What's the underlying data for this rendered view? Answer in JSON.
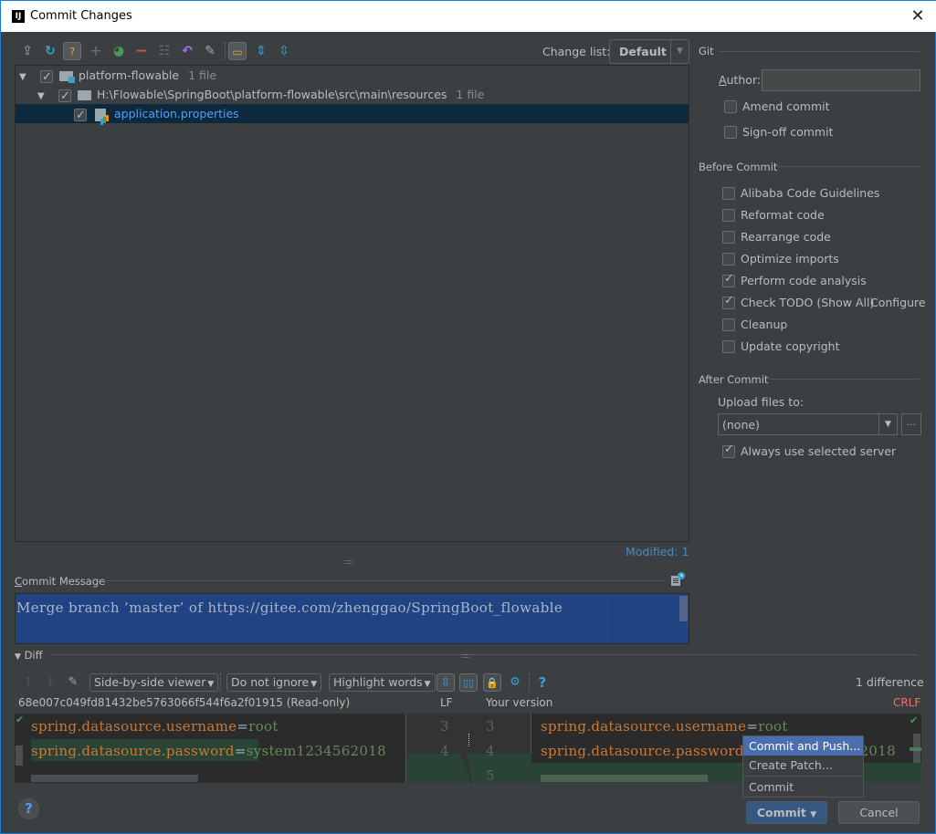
{
  "window": {
    "title": "Commit Changes",
    "logo": "IJ"
  },
  "toolbar": {
    "icons": [
      "vcs-update-icon",
      "refresh-icon",
      "unversioned-files-icon",
      "add-icon",
      "show-diff-icon",
      "remove-icon",
      "group-icon",
      "rollback-icon",
      "edit-source-icon",
      "show-module-icon",
      "expand-all-icon",
      "collapse-all-icon"
    ],
    "change_list_label": "Change list:",
    "change_list_value": "Default"
  },
  "tree": {
    "rows": [
      {
        "label": "platform-flowable",
        "count": "1 file",
        "checked": true
      },
      {
        "label": "H:\\Flowable\\SpringBoot\\platform-flowable\\src\\main\\resources",
        "count": "1 file",
        "checked": true
      },
      {
        "label": "application.properties",
        "checked": true
      }
    ],
    "modified_label": "Modified: 1"
  },
  "git": {
    "section_title": "Git",
    "author_label": "Author:",
    "author_value": "",
    "amend_commit": {
      "label": "Amend commit",
      "checked": false
    },
    "sign_off_commit": {
      "label": "Sign-off commit",
      "checked": false
    }
  },
  "before_commit": {
    "section_title": "Before Commit",
    "options": [
      {
        "label": "Alibaba Code Guidelines",
        "checked": false
      },
      {
        "label": "Reformat code",
        "checked": false
      },
      {
        "label": "Rearrange code",
        "checked": false
      },
      {
        "label": "Optimize imports",
        "checked": false
      },
      {
        "label": "Perform code analysis",
        "checked": true
      },
      {
        "label": "Check TODO (Show All)",
        "checked": true
      },
      {
        "label": "Cleanup",
        "checked": false
      },
      {
        "label": "Update copyright",
        "checked": false
      }
    ],
    "configure_link": "Configure"
  },
  "after_commit": {
    "section_title": "After Commit",
    "upload_label": "Upload files to:",
    "upload_value": "(none)",
    "browse_label": "...",
    "always_use": {
      "label": "Always use selected server",
      "checked": true
    }
  },
  "commit_message": {
    "label": "Commit Message",
    "text": "Merge branch ’master’ of https://gitee.com/zhenggao/SpringBoot_flowable"
  },
  "diff": {
    "section_title": "Diff",
    "viewer_mode": "Side-by-side viewer",
    "ignore_mode": "Do not ignore",
    "highlight_mode": "Highlight words",
    "help": "?",
    "difference_count": "1 difference",
    "left_title": "68e007c049fd81432be5763066f544f6a2f01915 (Read-only)",
    "left_line_sep": "LF",
    "right_title": "Your version",
    "right_line_sep": "CRLF",
    "left_lines": [
      {
        "num": "3",
        "key": "spring.datasource.username",
        "value": "root"
      },
      {
        "num": "4",
        "key": "spring.datasource.password",
        "value": "system1234562018"
      }
    ],
    "right_lines": [
      {
        "num": "3",
        "key": "spring.datasource.username",
        "value": "root"
      },
      {
        "num": "4",
        "key": "spring.datasource.password",
        "value": "system1234562018"
      },
      {
        "num": "5",
        "key": "",
        "value": ""
      }
    ]
  },
  "popup_menu": {
    "items": [
      "Commit and Push...",
      "Create Patch...",
      "Commit"
    ]
  },
  "buttons": {
    "commit": "Commit",
    "cancel": "Cancel",
    "help": "?"
  }
}
